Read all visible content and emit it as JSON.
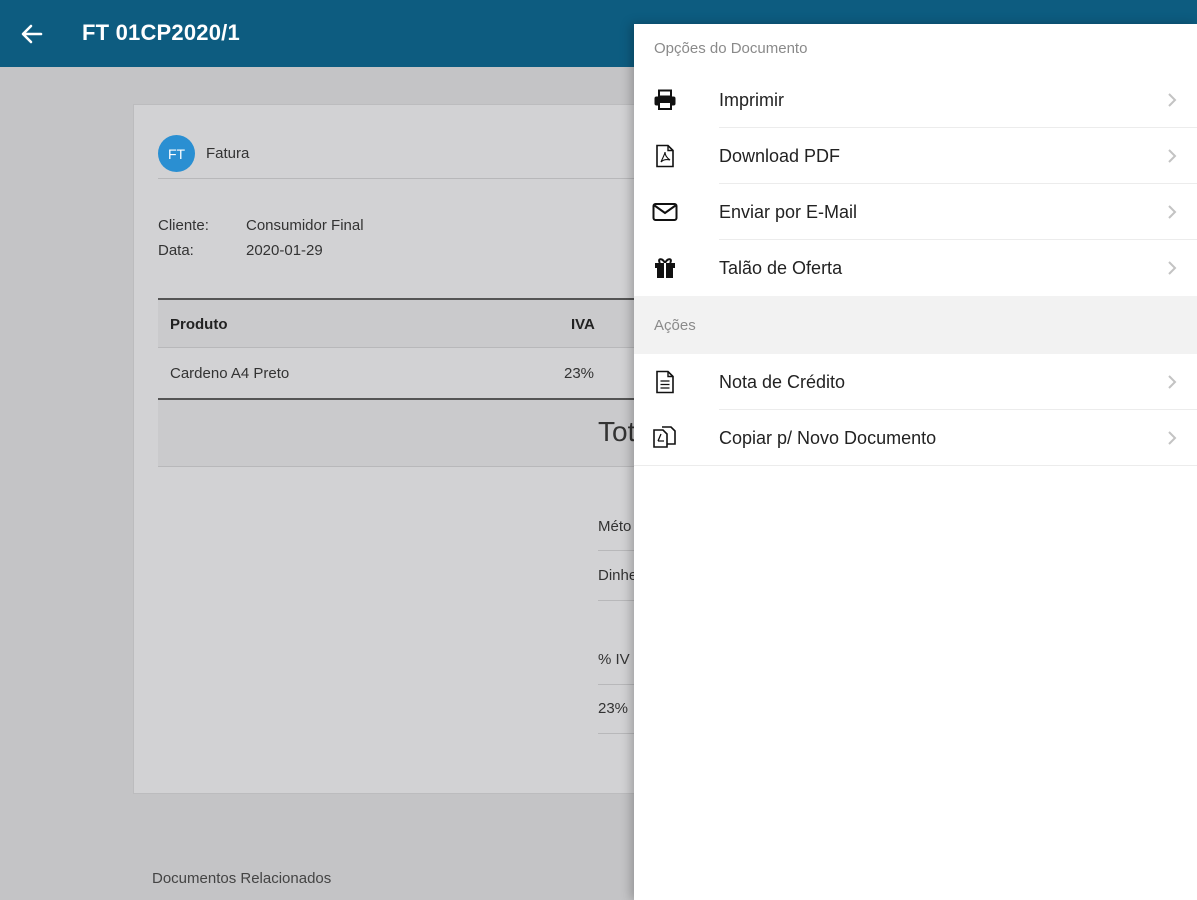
{
  "header": {
    "title": "FT 01CP2020/1",
    "back_icon": "arrow-left-icon"
  },
  "document": {
    "type_badge": "FT",
    "type_label": "Fatura",
    "client_label": "Cliente:",
    "client_value": "Consumidor Final",
    "date_label": "Data:",
    "date_value": "2020-01-29",
    "table": {
      "col_product": "Produto",
      "col_iva": "IVA",
      "rows": [
        {
          "product": "Cardeno A4 Preto",
          "iva": "23%"
        }
      ]
    },
    "total_fragment": "Tot",
    "payment_method_fragment": "Méto",
    "payment_value_fragment": "Dinhe",
    "vat_pct_fragment": "% IV",
    "vat_value_fragment": "23%"
  },
  "related_documents_label": "Documentos Relacionados",
  "options_panel": {
    "section_document": "Opções do Documento",
    "document_options": [
      {
        "label": "Imprimir",
        "icon": "printer-icon"
      },
      {
        "label": "Download PDF",
        "icon": "pdf-file-icon"
      },
      {
        "label": "Enviar por E-Mail",
        "icon": "envelope-icon"
      },
      {
        "label": "Talão de Oferta",
        "icon": "gift-icon"
      }
    ],
    "section_actions": "Ações",
    "action_options": [
      {
        "label": "Nota de Crédito",
        "icon": "document-icon"
      },
      {
        "label": "Copiar p/ Novo Documento",
        "icon": "copy-document-icon"
      }
    ]
  },
  "colors": {
    "header_bg": "#0d5c80",
    "badge_bg": "#2a8fd2",
    "overlay_bg": "#c4c4c6",
    "panel_bg": "#ffffff"
  }
}
